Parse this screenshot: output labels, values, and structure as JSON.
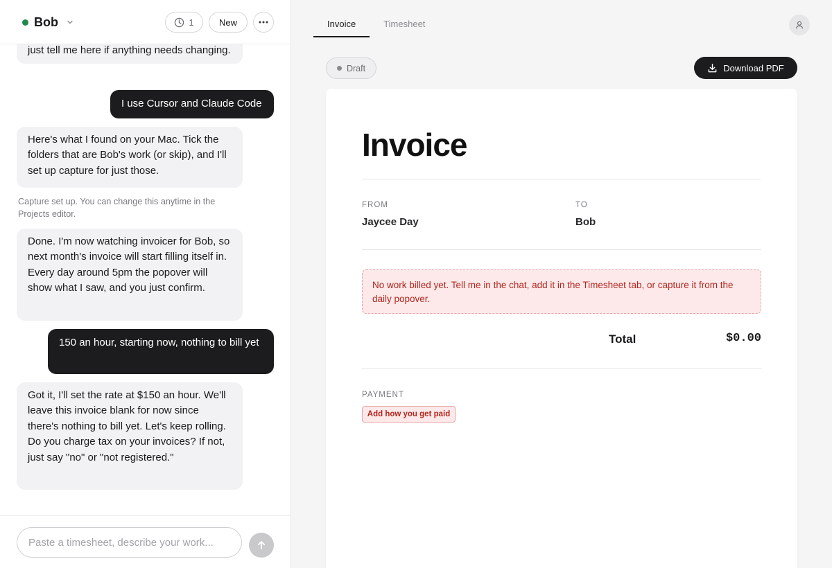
{
  "client": {
    "name": "Bob",
    "status_color": "#1f8a4c"
  },
  "header": {
    "history_count": "1",
    "new_label": "New"
  },
  "chat": {
    "messages": [
      {
        "role": "assistant",
        "text": "just tell me here if anything needs changing."
      },
      {
        "role": "user",
        "text": "I use Cursor and Claude Code"
      },
      {
        "role": "assistant",
        "text": "Here's what I found on your Mac. Tick the folders that are Bob's work (or skip), and I'll set up capture for just those."
      },
      {
        "role": "system",
        "text": "Capture set up. You can change this anytime in the Projects editor."
      },
      {
        "role": "assistant",
        "text": "Done. I'm now watching invoicer for Bob, so next month's invoice will start filling itself in. Every day around 5pm the popover will show what I saw, and you just confirm."
      },
      {
        "role": "user",
        "text": "150 an hour, starting now, nothing to bill yet"
      },
      {
        "role": "assistant",
        "text": "Got it, I'll set the rate at $150 an hour. We'll leave this invoice blank for now since there's nothing to bill yet. Let's keep rolling. Do you charge tax on your invoices? If not, just say \"no\" or \"not registered.\""
      }
    ],
    "composer_placeholder": "Paste a timesheet, describe your work..."
  },
  "tabs": [
    {
      "label": "Invoice",
      "active": true
    },
    {
      "label": "Timesheet",
      "active": false
    }
  ],
  "invoice": {
    "status": "Draft",
    "download_label": "Download PDF",
    "title": "Invoice",
    "from_label": "FROM",
    "from_value": "Jaycee Day",
    "to_label": "TO",
    "to_value": "Bob",
    "notice": "No work billed yet. Tell me in the chat, add it in the Timesheet tab, or capture it from the daily popover.",
    "total_label": "Total",
    "total_value": "$0.00",
    "payment_label": "PAYMENT",
    "payment_button": "Add how you get paid"
  },
  "colors": {
    "accent": "#1c1c1e",
    "warning_bg": "#fde9e9",
    "warning_text": "#b3261e"
  },
  "icons": {
    "history": "clock-icon",
    "more": "ellipsis-icon",
    "send": "arrow-up-icon",
    "download": "download-icon",
    "account": "user-icon",
    "dropdown": "chevron-down-icon"
  }
}
